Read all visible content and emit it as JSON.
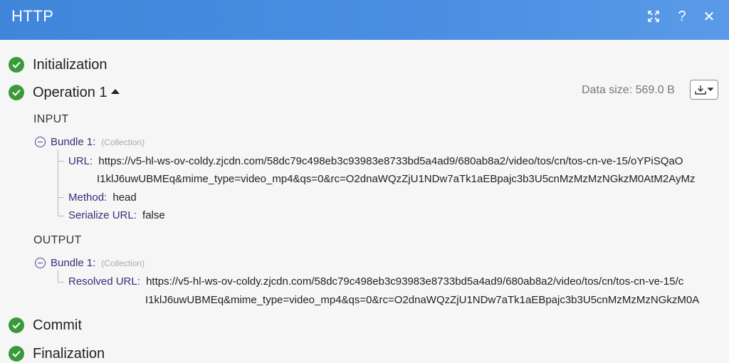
{
  "header": {
    "title": "HTTP"
  },
  "steps": {
    "initialization": "Initialization",
    "operation": "Operation 1",
    "commit": "Commit",
    "finalization": "Finalization"
  },
  "data_size": "Data size: 569.0 B",
  "input": {
    "title": "INPUT",
    "bundle_label": "Bundle 1:",
    "bundle_type": "(Collection)",
    "url_key": "URL:",
    "url_line1": "https://v5-hl-ws-ov-coldy.zjcdn.com/58dc79c498eb3c93983e8733bd5a4ad9/680ab8a2/video/tos/cn/tos-cn-ve-15/oYPiSQaO",
    "url_line2": "I1klJ6uwUBMEq&mime_type=video_mp4&qs=0&rc=O2dnaWQzZjU1NDw7aTk1aEBpajc3b3U5cnMzMzMzNGkzM0AtM2AyMz",
    "method_key": "Method:",
    "method_value": "head",
    "serialize_key": "Serialize URL:",
    "serialize_value": "false"
  },
  "output": {
    "title": "OUTPUT",
    "bundle_label": "Bundle 1:",
    "bundle_type": "(Collection)",
    "resolved_key": "Resolved URL:",
    "resolved_line1": "https://v5-hl-ws-ov-coldy.zjcdn.com/58dc79c498eb3c93983e8733bd5a4ad9/680ab8a2/video/tos/cn/tos-cn-ve-15/c",
    "resolved_line2": "I1klJ6uwUBMEq&mime_type=video_mp4&qs=0&rc=O2dnaWQzZjU1NDw7aTk1aEBpajc3b3U5cnMzMzMzNGkzM0A"
  },
  "icons": [
    "expand-icon",
    "help-icon",
    "close-icon",
    "check-icon",
    "caret-up-icon",
    "download-icon",
    "collapse-icon"
  ],
  "colors": {
    "header": "#4a8fe2",
    "success": "#3a9a3a",
    "key": "#3d2a78"
  }
}
